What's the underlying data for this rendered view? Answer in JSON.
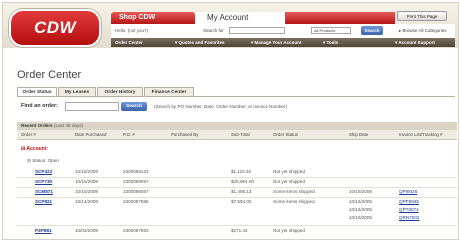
{
  "brand": {
    "logo": "CDW"
  },
  "header": {
    "tabs": [
      "Shop CDW",
      "My Account"
    ],
    "print_button": "Print This Page",
    "welcome": "Hello, (not you?)",
    "search_label": "Search for",
    "search_value": "",
    "category_select": "All Products",
    "search_button": "Search",
    "browse": "▸ Browse All Categories",
    "nav": [
      "Order Center",
      "▾ Quotes and Favorites",
      "▾ Manage Your Account",
      "▾ Tools",
      "▾ Account Support"
    ]
  },
  "page": {
    "title": "Order Center"
  },
  "subtabs": [
    "Order Status",
    "My Leases",
    "Order History",
    "Finance Center"
  ],
  "find": {
    "label": "Find an order:",
    "button": "Search",
    "hint": "(Search by PO Number, Date, Order Number, or Invoice Number)"
  },
  "recent": {
    "label": "Recent Orders",
    "count": "(Last 45 days)"
  },
  "columns": [
    "Order #",
    "Date Purchased",
    "P.O. #",
    "Purchased By",
    "Sub-Total",
    "Order Status",
    "Ship Date",
    "Invoice List/Tracking #"
  ],
  "groups": {
    "account": "Account:",
    "status": "Status: Open"
  },
  "rows": [
    {
      "order": "SCP423",
      "date": "10/15/2009",
      "po": "2300098123",
      "subtotal": "$1,110.32",
      "status": "Not yet shipped",
      "ship": [],
      "invoice": []
    },
    {
      "order": "SCP730",
      "date": "10/15/2009",
      "po": "2300098057",
      "subtotal": "$25,964.00",
      "status": "Not yet shipped",
      "ship": [],
      "invoice": []
    },
    {
      "order": "SCM871",
      "date": "10/15/2009",
      "po": "2300098067",
      "subtotal": "$1,495.13",
      "status": "Some items shipped",
      "ship": [
        "10/16/2009"
      ],
      "invoice": [
        "QPI0026"
      ]
    },
    {
      "order": "SCP821",
      "date": "10/14/2009",
      "po": "2300097895",
      "subtotal": "$7,594.00",
      "status": "Some items shipped",
      "ship": [
        "10/16/2009",
        "10/16/2009",
        "10/16/2009"
      ],
      "invoice": [
        "QPP6045",
        "QPT0074",
        "QRN7002"
      ]
    },
    {
      "order": "PZP881",
      "date": "10/02/2009",
      "po": "2300097963",
      "subtotal": "$271.44",
      "status": "Not yet shipped",
      "ship": [],
      "invoice": []
    }
  ]
}
